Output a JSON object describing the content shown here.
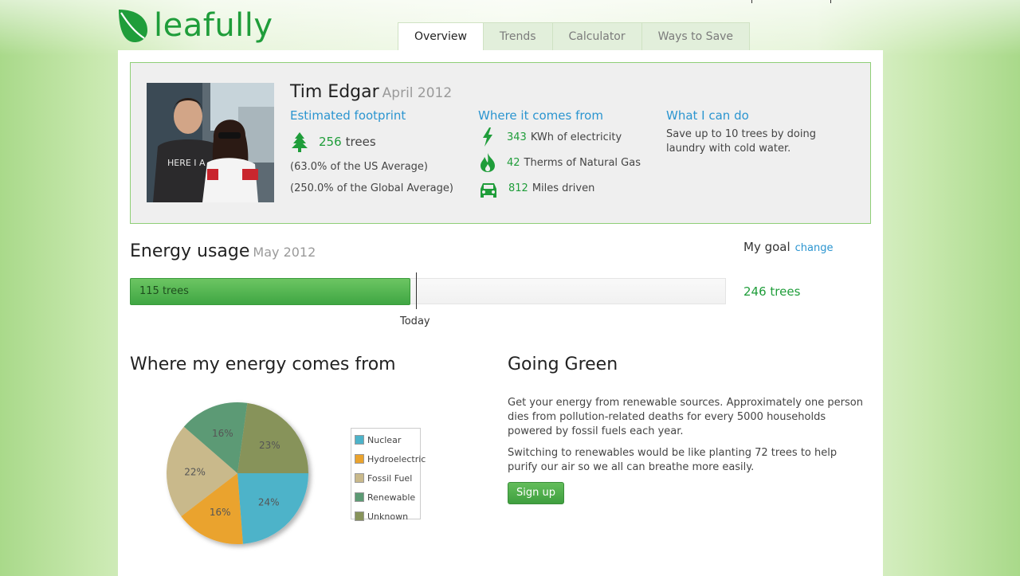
{
  "brand": {
    "name": "leafully",
    "color": "#1f9d3a",
    "accent": "#2b95d0"
  },
  "tabs": [
    {
      "label": "Overview",
      "active": true
    },
    {
      "label": "Trends",
      "active": false
    },
    {
      "label": "Calculator",
      "active": false
    },
    {
      "label": "Ways to Save",
      "active": false
    }
  ],
  "profile": {
    "name": "Tim Edgar",
    "month": "April 2012",
    "footprint": {
      "title": "Estimated footprint",
      "trees_value": "256",
      "trees_unit": "trees",
      "us_average": "(63.0% of the US Average)",
      "global_average": "(250.0% of the Global Average)"
    },
    "sources": {
      "title": "Where it comes from",
      "items": [
        {
          "icon": "lightning-icon",
          "value": "343",
          "label": "KWh of electricity"
        },
        {
          "icon": "flame-icon",
          "value": "42",
          "label": "Therms of Natural Gas"
        },
        {
          "icon": "car-icon",
          "value": "812",
          "label": "Miles driven"
        }
      ]
    },
    "todo": {
      "title": "What I can do",
      "text": "Save up to 10 trees by doing laundry with cold water."
    }
  },
  "energy_usage": {
    "title": "Energy usage",
    "month": "May 2012",
    "current_label": "115 trees",
    "progress_fraction": 0.47,
    "today_label": "Today",
    "goal_label": "My goal",
    "goal_change": "change",
    "goal_value": "246 trees"
  },
  "energy_sources": {
    "title": "Where my energy comes from"
  },
  "chart_data": {
    "type": "pie",
    "slices": [
      {
        "name": "Nuclear",
        "value": 24,
        "label": "24%",
        "color": "#4db3c9"
      },
      {
        "name": "Hydroelectric",
        "value": 16,
        "label": "16%",
        "color": "#eaa32e"
      },
      {
        "name": "Fossil Fuel",
        "value": 22,
        "label": "22%",
        "color": "#c9b98b"
      },
      {
        "name": "Renewable",
        "value": 16,
        "label": "16%",
        "color": "#5c9a74"
      },
      {
        "name": "Unknown",
        "value": 23,
        "label": "23%",
        "color": "#87935a"
      }
    ],
    "legend": "right"
  },
  "going_green": {
    "title": "Going Green",
    "paragraph1": "Get your energy from renewable sources. Approximately one person dies from pollution-related deaths for every 5000 households powered by fossil fuels each year.",
    "paragraph2": "Switching to renewables would be like planting 72 trees to help purify our air so we all can breathe more easily.",
    "button": "Sign up"
  }
}
